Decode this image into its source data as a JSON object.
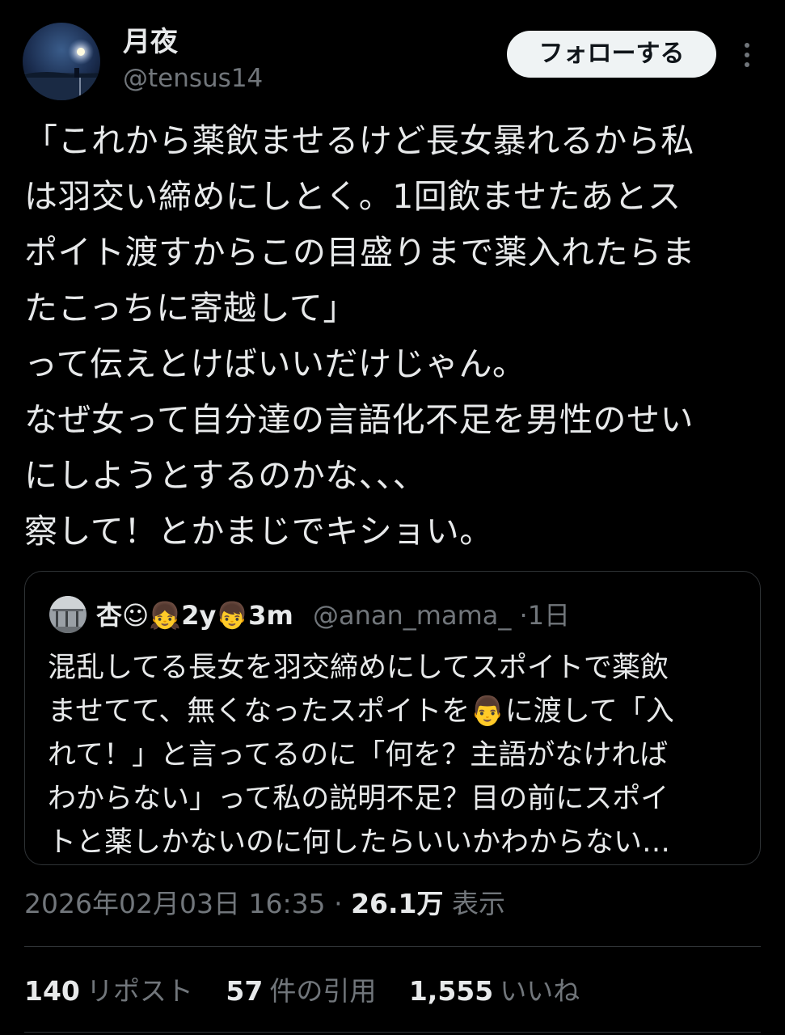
{
  "author": {
    "display_name": "月夜",
    "handle": "@tensus14",
    "avatar": "moon-lake-avatar"
  },
  "follow_button": "フォローする",
  "more_icon": "more-vertical-icon",
  "tweet_lines": [
    "「これから薬飲ませるけど長女暴れるから私",
    "は羽交い締めにしとく。1回飲ませたあとス",
    "ポイト渡すからこの目盛りまで薬入れたらま",
    "たこっちに寄越して」",
    "って伝えとけばいいだけじゃん。",
    "なぜ女って自分達の言語化不足を男性のせい",
    "にしようとするのかな、、、",
    "察して！とかまじでキショい。"
  ],
  "quote": {
    "display_name": "杏☺👧2y👦3m",
    "handle": "@anan_mama_",
    "separator": "·",
    "time": "1日",
    "text_lines": [
      "混乱してる長女を羽交締めにしてスポイトで薬飲",
      "ませてて、無くなったスポイトを👨に渡して「入",
      "れて！」と言ってるのに「何を？主語がなければ",
      "わからない」って私の説明不足？目の前にスポイ",
      "トと薬しかないのに何したらいいかわからない…"
    ]
  },
  "meta": {
    "datetime": "2026年02月03日 16:35",
    "separator": "·",
    "views_count": "26.1万",
    "views_label": "表示"
  },
  "stats": {
    "reposts_count": "140",
    "reposts_label": "リポスト",
    "quotes_count": "57",
    "quotes_label": "件の引用",
    "likes_count": "1,555",
    "likes_label": "いいね"
  }
}
